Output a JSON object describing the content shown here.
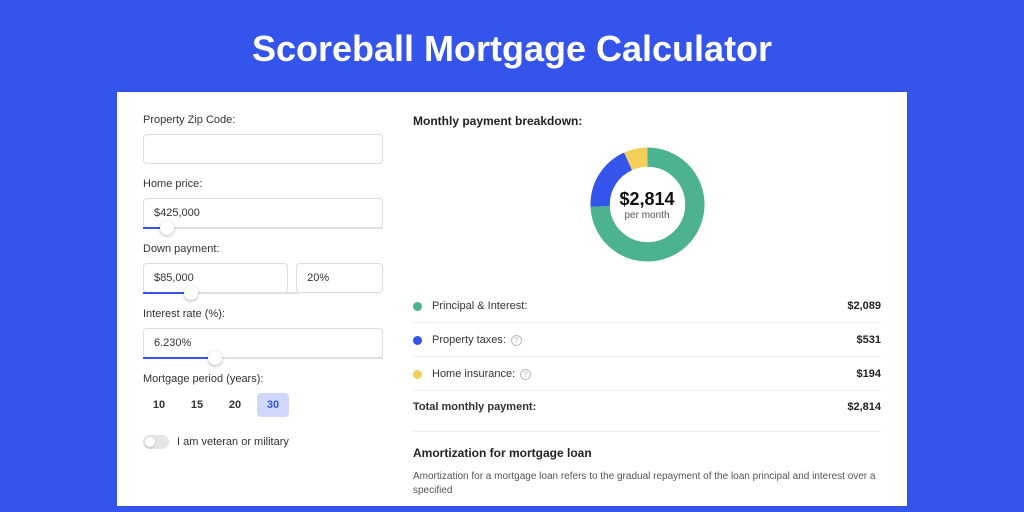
{
  "title": "Scoreball Mortgage Calculator",
  "form": {
    "zip_label": "Property Zip Code:",
    "zip_value": "",
    "homeprice_label": "Home price:",
    "homeprice_value": "$425,000",
    "homeprice_slider_pct": 10,
    "down_label": "Down payment:",
    "down_value": "$85,000",
    "down_pct_value": "20%",
    "down_slider_pct": 20,
    "rate_label": "Interest rate (%):",
    "rate_value": "6.230%",
    "rate_slider_pct": 30,
    "period_label": "Mortgage period (years):",
    "periods": [
      "10",
      "15",
      "20",
      "30"
    ],
    "period_active_index": 3,
    "veteran_label": "I am veteran or military"
  },
  "breakdown": {
    "title": "Monthly payment breakdown:",
    "center_amount": "$2,814",
    "center_sub": "per month",
    "items": [
      {
        "label": "Principal & Interest:",
        "value": "$2,089",
        "color": "#4cb28f",
        "info": false
      },
      {
        "label": "Property taxes:",
        "value": "$531",
        "color": "#3454ec",
        "info": true
      },
      {
        "label": "Home insurance:",
        "value": "$194",
        "color": "#f2cf5b",
        "info": true
      }
    ],
    "total_label": "Total monthly payment:",
    "total_value": "$2,814"
  },
  "amort": {
    "title": "Amortization for mortgage loan",
    "body": "Amortization for a mortgage loan refers to the gradual repayment of the loan principal and interest over a specified"
  },
  "chart_data": {
    "type": "pie",
    "title": "Monthly payment breakdown",
    "series": [
      {
        "name": "Principal & Interest",
        "value": 2089,
        "color": "#4cb28f"
      },
      {
        "name": "Property taxes",
        "value": 531,
        "color": "#3454ec"
      },
      {
        "name": "Home insurance",
        "value": 194,
        "color": "#f2cf5b"
      }
    ],
    "total": 2814,
    "center_label": "$2,814 per month"
  }
}
